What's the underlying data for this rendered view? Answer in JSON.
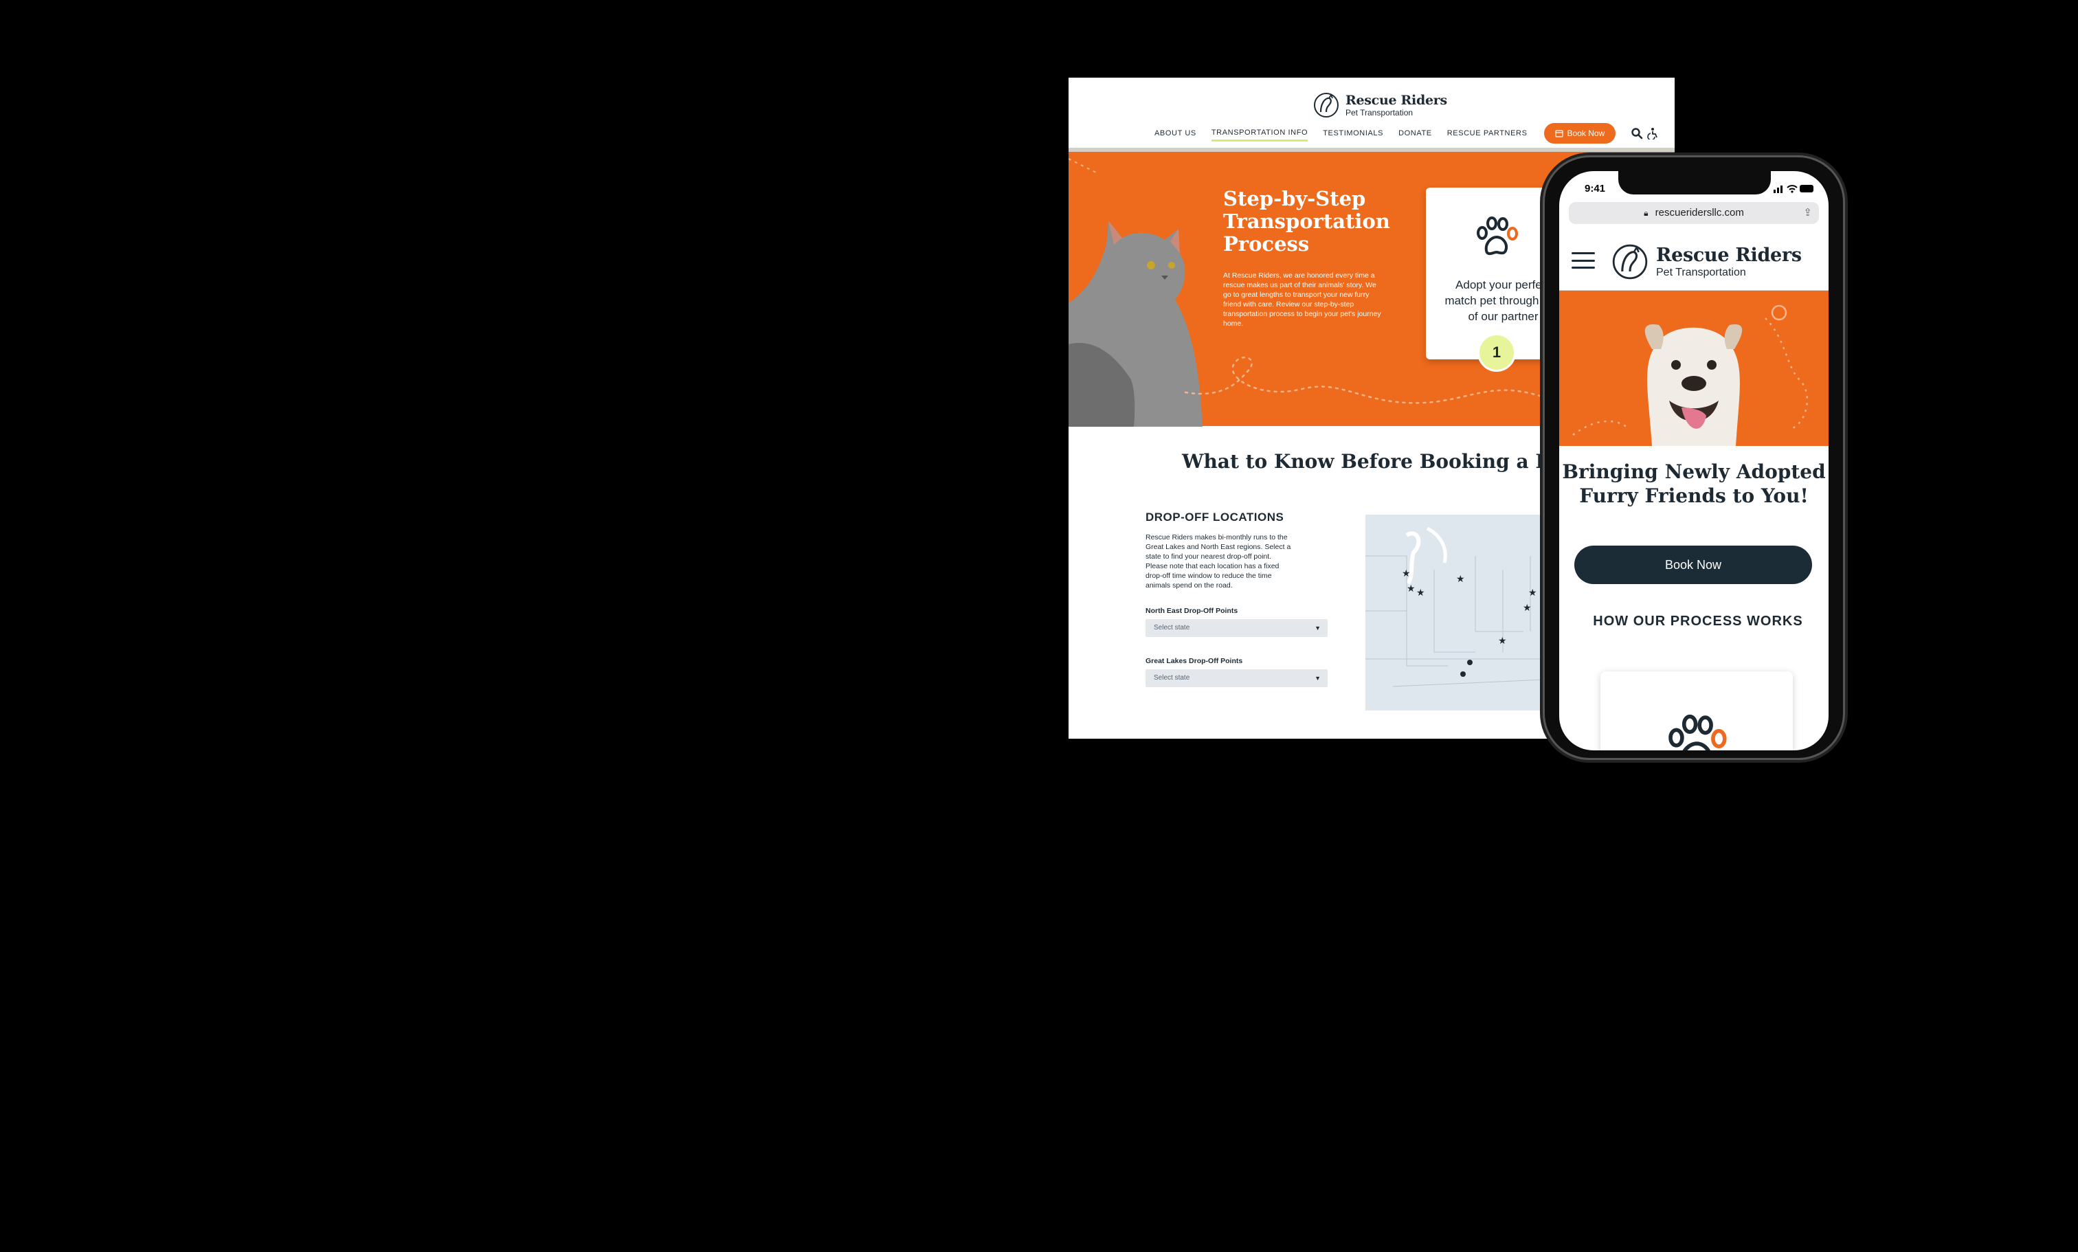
{
  "brand": {
    "name": "Rescue Riders",
    "tagline": "Pet Transportation",
    "colors": {
      "orange": "#ee6a1c",
      "navy": "#1c2c37",
      "lime": "#e8f49a"
    }
  },
  "desktop": {
    "nav": [
      {
        "label": "ABOUT US"
      },
      {
        "label": "TRANSPORTATION INFO"
      },
      {
        "label": "TESTIMONIALS"
      },
      {
        "label": "DONATE"
      },
      {
        "label": "RESCUE PARTNERS"
      }
    ],
    "book_label": "Book Now",
    "icons": [
      "calendar-icon",
      "search-icon",
      "accessibility-icon"
    ],
    "hero": {
      "title": "Step-by-Step Transportation Process",
      "text": "At Rescue Riders, we are honored every time a rescue makes us part of their animals' story. We go to great lengths to transport your new furry friend with care. Review our step-by-step transportation process to begin your pet's journey home.",
      "card_text": "Adopt your perfect match pet through one of our partner",
      "step_number": "1"
    },
    "section_title": "What to Know Before Booking a Ride",
    "dropoff": {
      "heading": "DROP-OFF LOCATIONS",
      "text": "Rescue Riders makes bi-monthly runs to the Great Lakes and North East regions. Select a state to find your nearest drop-off point. Please note that each location has a fixed drop-off time window to reduce the time animals spend on the road.",
      "fields": [
        {
          "label": "North East Drop-Off Points",
          "placeholder": "Select state"
        },
        {
          "label": "Great Lakes Drop-Off Points",
          "placeholder": "Select state"
        }
      ]
    }
  },
  "mobile": {
    "status_time": "9:41",
    "url": "rescueridersllc.com",
    "hero_title": "Bringing Newly Adopted Furry Friends to You!",
    "book_label": "Book Now",
    "process_heading": "HOW OUR PROCESS WORKS"
  }
}
